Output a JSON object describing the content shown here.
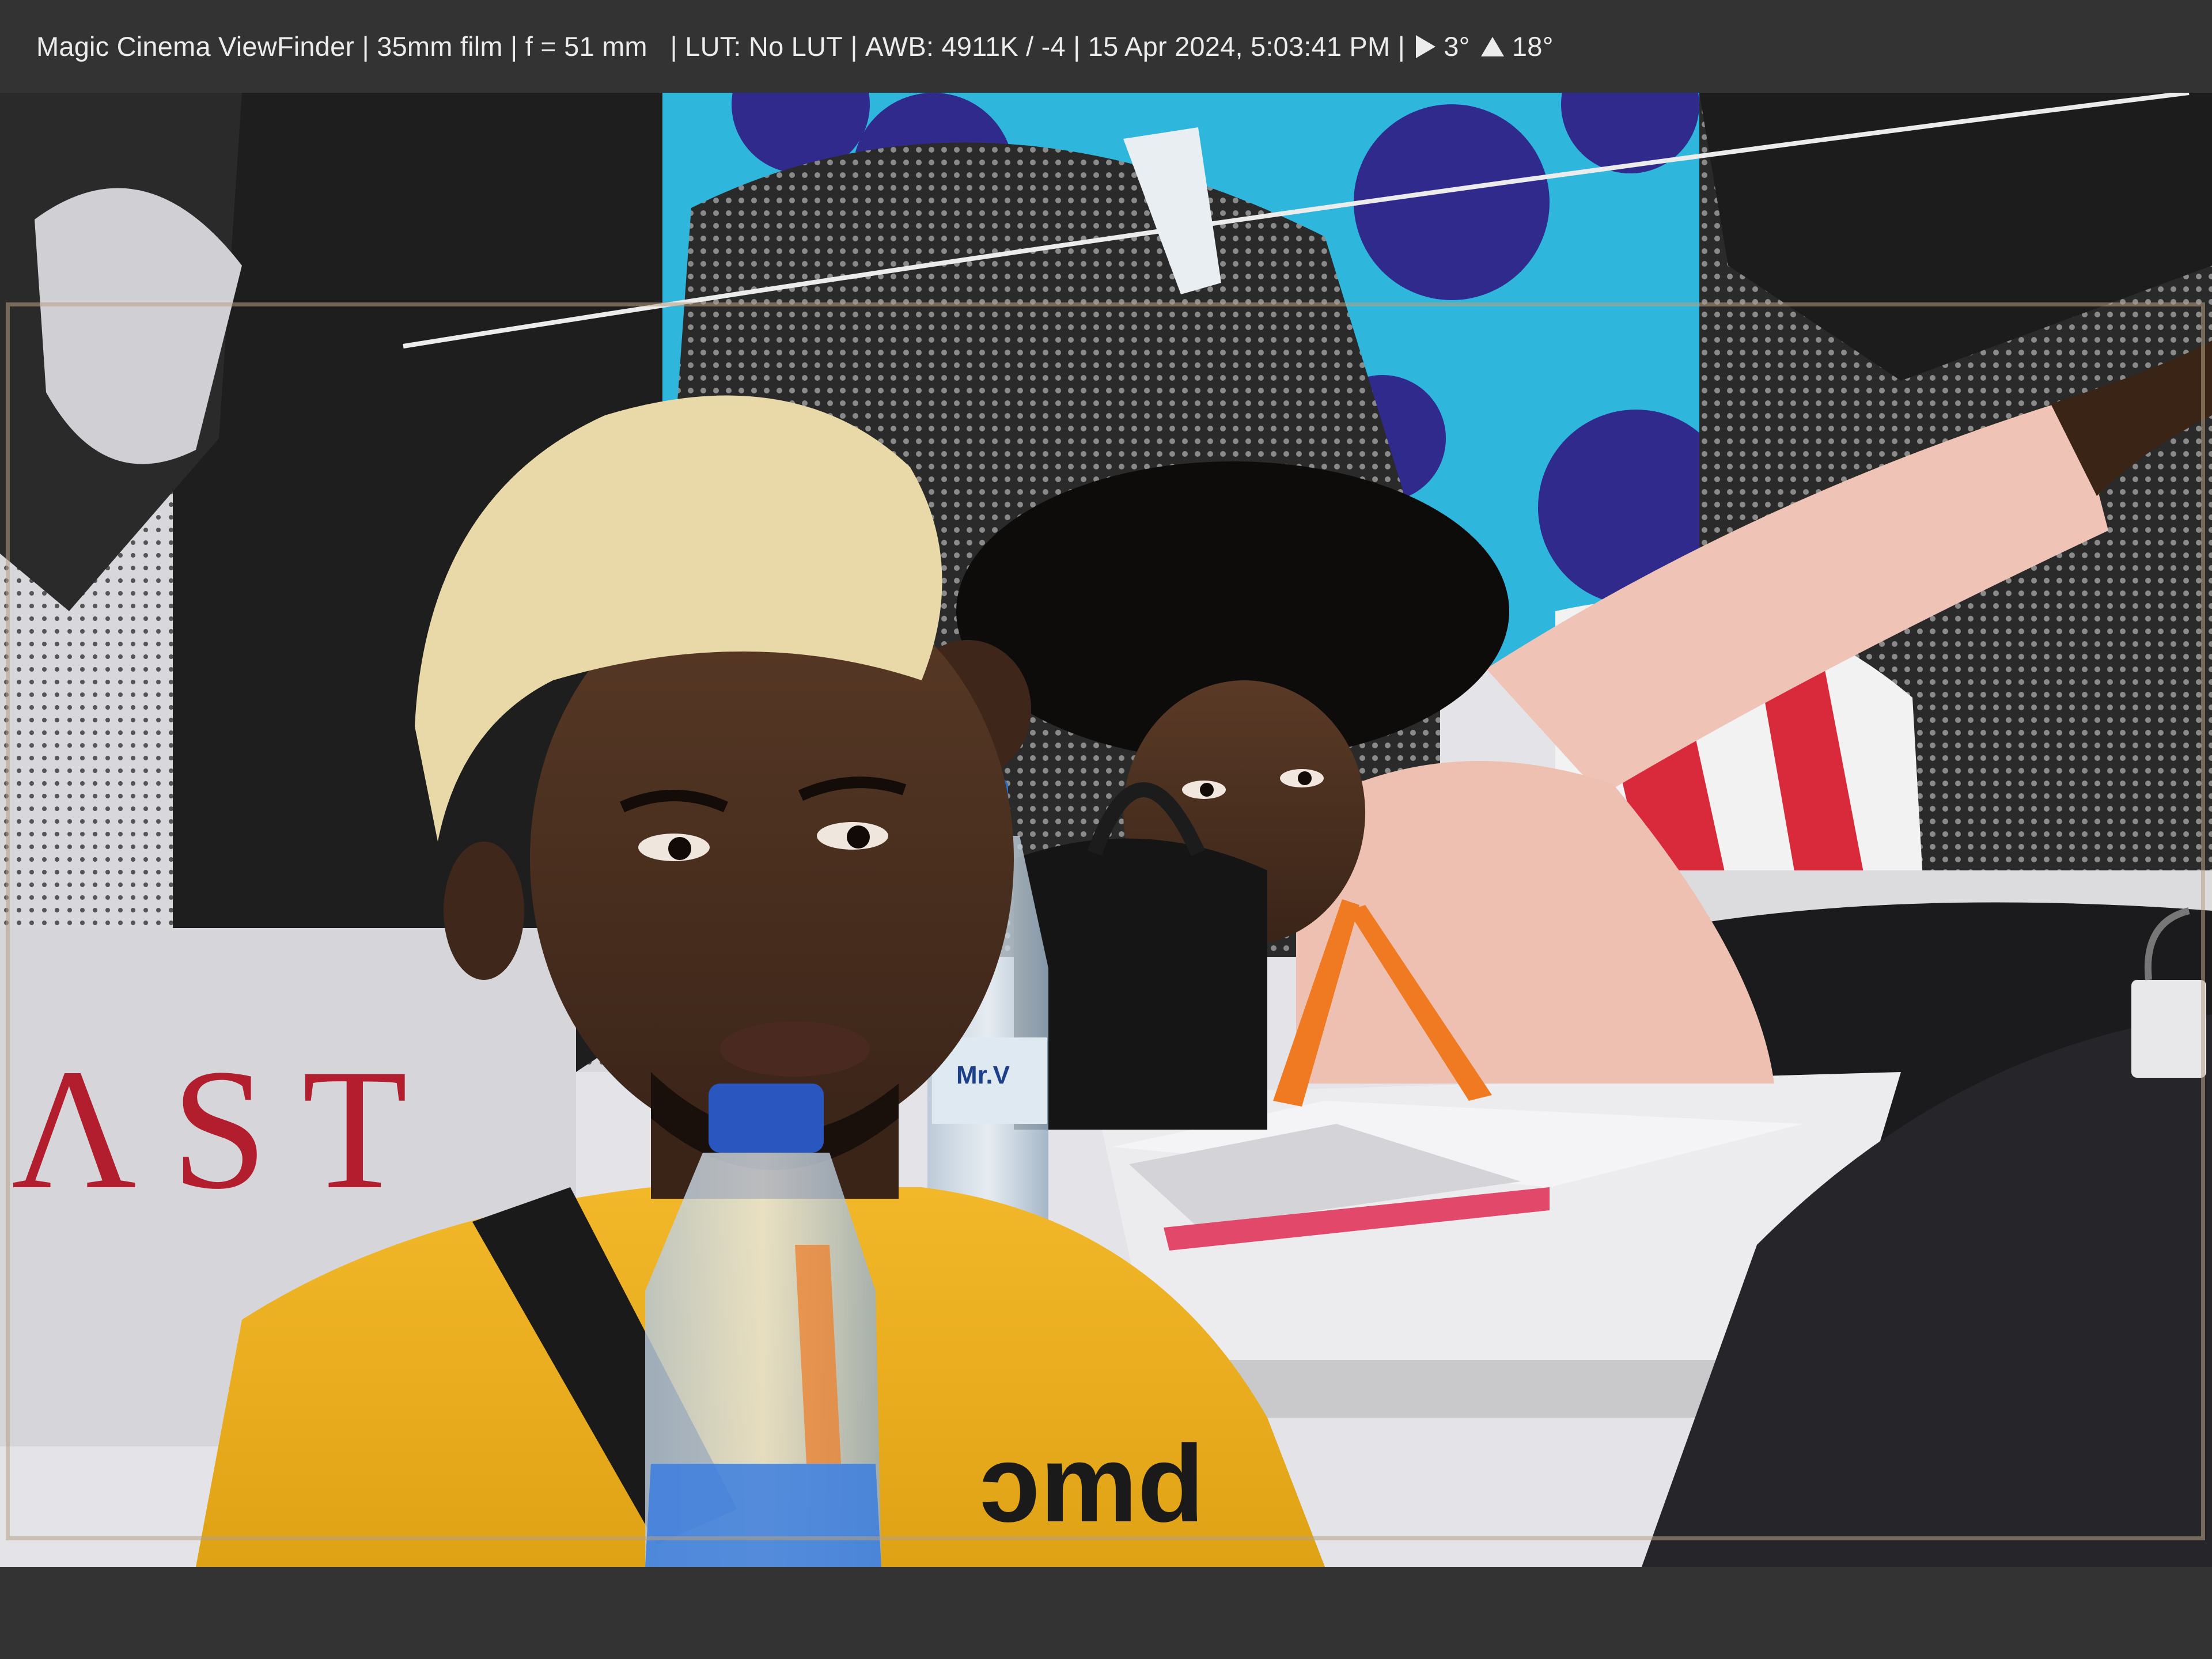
{
  "app": {
    "name": "Magic Cinema ViewFinder"
  },
  "status": {
    "format": "35mm film",
    "focal": "f = 51 mm",
    "lut": "LUT: No LUT",
    "awb": "AWB: 4911K / -4",
    "datetime": "15 Apr 2024, 5:03:41 PM",
    "tilt": "3°",
    "roll": "18°"
  },
  "photo": {
    "bottle_label": "Mr.V",
    "wall_letters": "ΛST"
  },
  "colors": {
    "bar": "#333333",
    "text": "#ececec",
    "frame_guide": "#b4a082"
  },
  "icons": {
    "tilt": "play-triangle-icon",
    "roll": "up-triangle-icon"
  }
}
